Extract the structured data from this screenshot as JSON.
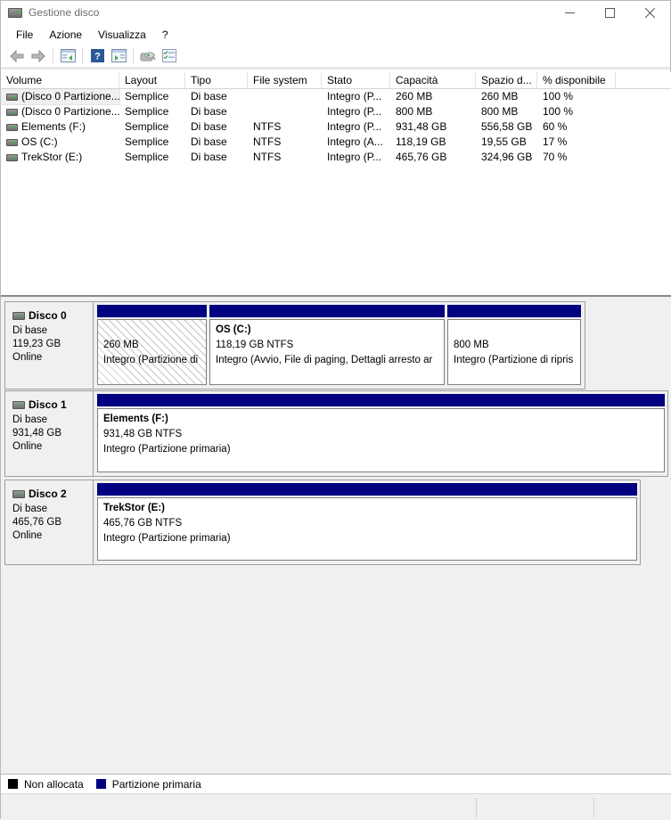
{
  "window": {
    "title": "Gestione disco",
    "controls": {
      "minimize": "–",
      "maximize": "☐",
      "close": "✕"
    }
  },
  "menu": {
    "items": [
      "File",
      "Azione",
      "Visualizza",
      "?"
    ]
  },
  "toolbar": {
    "icons": [
      "back-icon",
      "forward-icon",
      "show-console-tree-icon",
      "help-icon",
      "show-action-pane-icon",
      "console-properties-icon",
      "checklist-icon"
    ]
  },
  "volume_list": {
    "columns": [
      "Volume",
      "Layout",
      "Tipo",
      "File system",
      "Stato",
      "Capacità",
      "Spazio d...",
      "% disponibile"
    ],
    "rows": [
      {
        "volume": "(Disco 0 Partizione...",
        "layout": "Semplice",
        "tipo": "Di base",
        "fs": "",
        "stato": "Integro (P...",
        "capacita": "260 MB",
        "spazio": "260 MB",
        "pct": "100 %"
      },
      {
        "volume": "(Disco 0 Partizione...",
        "layout": "Semplice",
        "tipo": "Di base",
        "fs": "",
        "stato": "Integro (P...",
        "capacita": "800 MB",
        "spazio": "800 MB",
        "pct": "100 %"
      },
      {
        "volume": "Elements (F:)",
        "layout": "Semplice",
        "tipo": "Di base",
        "fs": "NTFS",
        "stato": "Integro (P...",
        "capacita": "931,48 GB",
        "spazio": "556,58 GB",
        "pct": "60 %"
      },
      {
        "volume": "OS (C:)",
        "layout": "Semplice",
        "tipo": "Di base",
        "fs": "NTFS",
        "stato": "Integro (A...",
        "capacita": "118,19 GB",
        "spazio": "19,55 GB",
        "pct": "17 %"
      },
      {
        "volume": "TrekStor (E:)",
        "layout": "Semplice",
        "tipo": "Di base",
        "fs": "NTFS",
        "stato": "Integro (P...",
        "capacita": "465,76 GB",
        "spazio": "324,96 GB",
        "pct": "70 %"
      }
    ]
  },
  "disks": [
    {
      "name": "Disco 0",
      "type": "Di base",
      "size": "119,23 GB",
      "status": "Online",
      "partitions": [
        {
          "name": "",
          "size": "260 MB",
          "status": "Integro (Partizione di"
        },
        {
          "name": "OS  (C:)",
          "size": "118,19 GB NTFS",
          "status": "Integro (Avvio, File di paging, Dettagli arresto ar"
        },
        {
          "name": "",
          "size": "800 MB",
          "status": "Integro (Partizione di ripris"
        }
      ]
    },
    {
      "name": "Disco 1",
      "type": "Di base",
      "size": "931,48 GB",
      "status": "Online",
      "partitions": [
        {
          "name": "Elements  (F:)",
          "size": "931,48 GB NTFS",
          "status": "Integro (Partizione primaria)"
        }
      ]
    },
    {
      "name": "Disco 2",
      "type": "Di base",
      "size": "465,76 GB",
      "status": "Online",
      "partitions": [
        {
          "name": "TrekStor  (E:)",
          "size": "465,76 GB NTFS",
          "status": "Integro (Partizione primaria)"
        }
      ]
    }
  ],
  "legend": {
    "items": [
      {
        "label": "Non allocata",
        "color": "#000000"
      },
      {
        "label": "Partizione primaria",
        "color": "#000080"
      }
    ]
  },
  "colors": {
    "partition_primary": "#000080",
    "unallocated": "#000000",
    "pane_bg": "#f0f0f0"
  }
}
